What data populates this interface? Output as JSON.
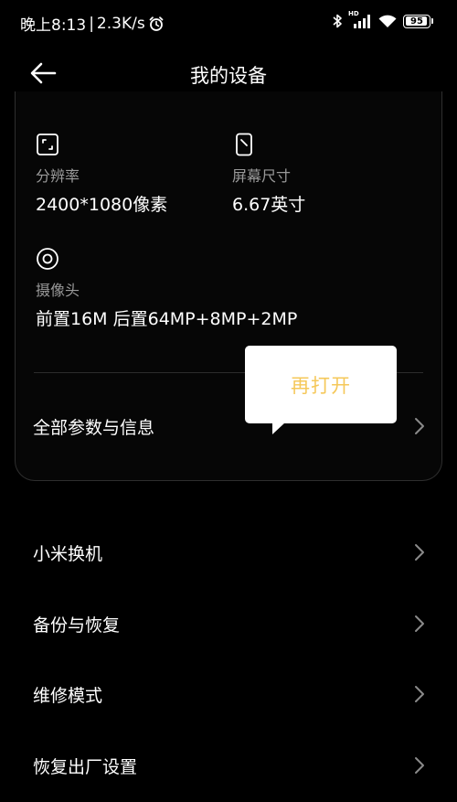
{
  "status_bar": {
    "time": "晚上8:13",
    "separator": "|",
    "net_speed": "2.3K/s",
    "hd_label": "HD",
    "battery_level": 95,
    "battery_text": "95"
  },
  "header": {
    "title": "我的设备"
  },
  "specs": [
    {
      "label": "分辨率",
      "value": "2400*1080像素"
    },
    {
      "label": "屏幕尺寸",
      "value": "6.67英寸"
    },
    {
      "label": "摄像头",
      "value": "前置16M 后置64MP+8MP+2MP"
    }
  ],
  "all_params": {
    "label": "全部参数与信息"
  },
  "tooltip": {
    "text": "再打开"
  },
  "menu": [
    {
      "label": "小米换机"
    },
    {
      "label": "备份与恢复"
    },
    {
      "label": "维修模式"
    },
    {
      "label": "恢复出厂设置"
    }
  ],
  "colors": {
    "background": "#000000",
    "tooltip_text": "#f5c85a",
    "label_gray": "#9a9a9a"
  }
}
